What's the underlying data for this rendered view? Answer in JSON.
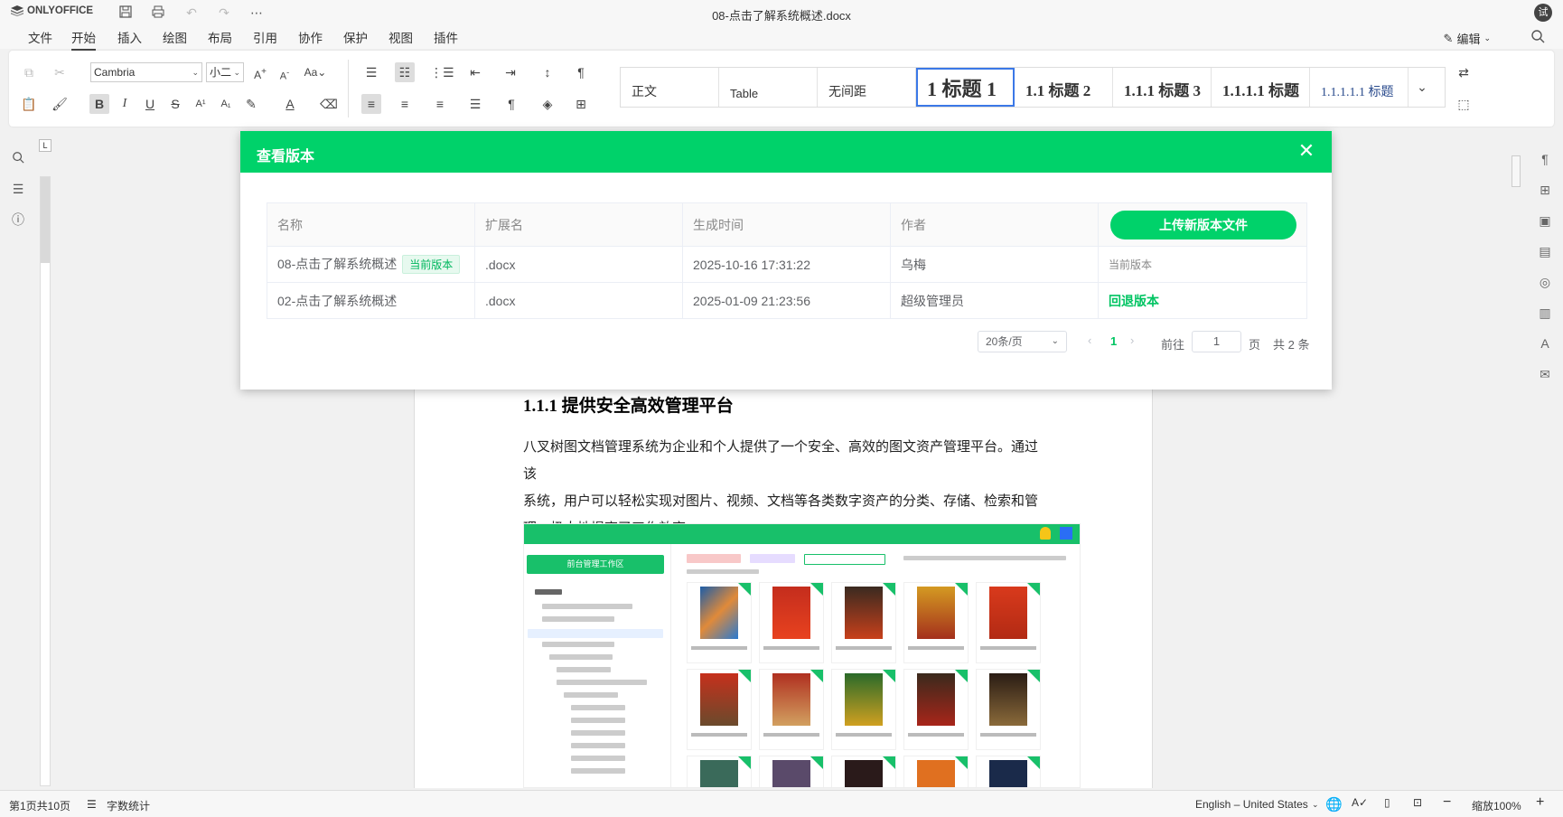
{
  "app": {
    "logo_text": "ONLYOFFICE",
    "doc_title": "08-点击了解系统概述.docx",
    "avatar_initial": "试"
  },
  "menu": {
    "tabs": [
      "文件",
      "开始",
      "插入",
      "绘图",
      "布局",
      "引用",
      "协作",
      "保护",
      "视图",
      "插件"
    ],
    "active_tab": "开始",
    "edit_mode_label": "编辑"
  },
  "toolbar": {
    "font_name": "Cambria",
    "font_size": "小二",
    "styles": [
      "正文",
      "Table",
      "无间距",
      "1 标题 1",
      "1.1 标题 2",
      "1.1.1 标题 3",
      "1.1.1.1 标题",
      "1.1.1.1.1 标题"
    ],
    "selected_style": "1 标题 1"
  },
  "document": {
    "heading": "1.1.1 提供安全高效管理平台",
    "paragraph_lines": [
      "八叉树图文档管理系统为企业和个人提供了一个安全、高效的图文资产管理平台。通过该",
      "系统，用户可以轻松实现对图片、视频、文档等各类数字资产的分类、存储、检索和管",
      "理，极大地提高了工作效率。"
    ],
    "embedded_shot_button": "前台管理工作区"
  },
  "modal": {
    "title": "查看版本",
    "columns": [
      "名称",
      "扩展名",
      "生成时间",
      "作者"
    ],
    "upload_button": "上传新版本文件",
    "rows": [
      {
        "name": "08-点击了解系统概述",
        "badge": "当前版本",
        "ext": ".docx",
        "time": "2025-10-16 17:31:22",
        "author": "乌梅",
        "action": "当前版本"
      },
      {
        "name": "02-点击了解系统概述",
        "badge": "",
        "ext": ".docx",
        "time": "2025-01-09 21:23:56",
        "author": "超级管理员",
        "action": "回退版本"
      }
    ],
    "pagination": {
      "page_size": "20条/页",
      "current_page": "1",
      "goto_label": "前往",
      "goto_value": "1",
      "page_unit": "页",
      "total": "共 2 条"
    }
  },
  "status": {
    "page_info": "第1页共10页",
    "word_count": "字数统计",
    "language": "English – United States",
    "zoom": "缩放100%"
  },
  "colors": {
    "accent_green": "#00d26a",
    "selected_style_border": "#3b78e7"
  }
}
